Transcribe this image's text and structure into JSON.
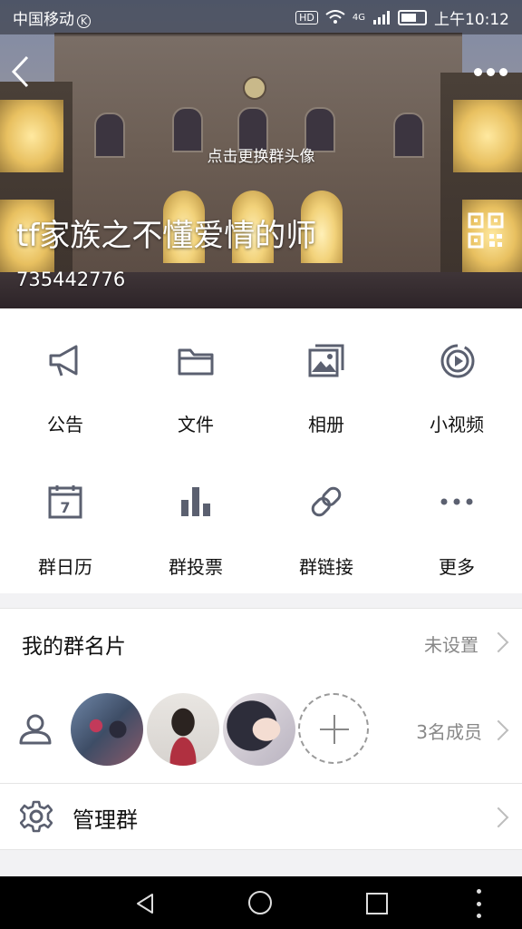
{
  "status_bar": {
    "carrier": "中国移动",
    "hd_badge": "HD",
    "network": "4G",
    "time": "上午10:12"
  },
  "header": {
    "change_avatar_hint": "点击更换群头像",
    "group_name": "tf家族之不懂爱情的师",
    "group_id": "735442776"
  },
  "features": [
    {
      "label": "公告",
      "icon": "megaphone-icon"
    },
    {
      "label": "文件",
      "icon": "folder-icon"
    },
    {
      "label": "相册",
      "icon": "album-icon"
    },
    {
      "label": "小视频",
      "icon": "video-icon"
    },
    {
      "label": "群日历",
      "icon": "calendar-icon",
      "calendar_day": "7"
    },
    {
      "label": "群投票",
      "icon": "bar-chart-icon"
    },
    {
      "label": "群链接",
      "icon": "link-icon"
    },
    {
      "label": "更多",
      "icon": "more-dots-icon"
    }
  ],
  "group_card": {
    "title": "我的群名片",
    "value": "未设置"
  },
  "members": {
    "count_label": "3名成员"
  },
  "manage": {
    "title": "管理群"
  },
  "colors": {
    "icon_gray": "#5b6070",
    "secondary_text": "#888888"
  }
}
